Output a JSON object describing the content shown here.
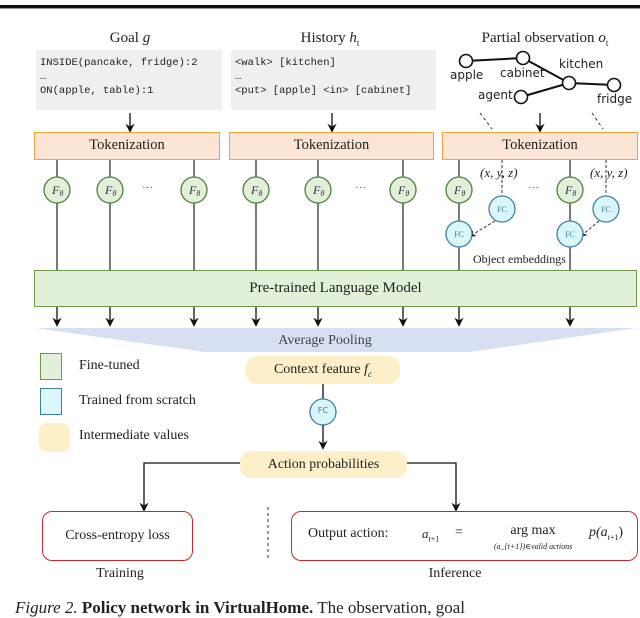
{
  "figure": {
    "columns": [
      {
        "title": "Goal ",
        "title_var": "g",
        "lines": [
          "INSIDE(pancake, fridge):2",
          "…",
          "ON(apple, table):1"
        ]
      },
      {
        "title": "History ",
        "title_var": "h",
        "title_sub": "t",
        "lines": [
          "<walk> [kitchen]",
          "…",
          "<put> [apple] <in> [cabinet]"
        ]
      },
      {
        "title": "Partial observation ",
        "title_var": "o",
        "title_sub": "t",
        "graph_nodes": [
          "apple",
          "cabinet",
          "kitchen",
          "agent",
          "fridge"
        ]
      }
    ],
    "tokenization_label": "Tokenization",
    "f_theta_label": "F",
    "f_theta_sub": "θ",
    "ellipsis": "···",
    "fc_label": "FC",
    "coords_label": "(x, y, z)",
    "object_embeddings_label": "Object embeddings",
    "language_model_label": "Pre-trained Language Model",
    "average_pooling_label": "Average Pooling",
    "context_feature_label": "Context feature ",
    "context_feature_var": "f",
    "context_feature_sub": "c",
    "action_probabilities_label": "Action probabilities",
    "loss_label": "Cross-entropy loss",
    "output_action_label": "Output action:",
    "output_formula": {
      "lhs": "a",
      "lhs_sub": "t+1",
      "eq": "=",
      "op": "arg max",
      "op_under": "(a_{t+1})∈valid actions",
      "rhs": "p(a",
      "rhs_sub": "t+1",
      "rhs_close": ")"
    },
    "training_label": "Training",
    "inference_label": "Inference",
    "legend": [
      {
        "label": "Fine-tuned",
        "fill": "#e2efd9",
        "stroke": "#6a9a4a"
      },
      {
        "label": "Trained from scratch",
        "fill": "#d9f6fb",
        "stroke": "#41809e"
      },
      {
        "label": "Intermediate values",
        "fill": "#fdefc8",
        "stroke": "none"
      }
    ],
    "caption_prefix": "Figure 2.",
    "caption_bold": "Policy network in VirtualHome.",
    "caption_rest": "The observation, goal"
  },
  "colors": {
    "tokenization_fill": "#fce4d6",
    "tokenization_stroke": "#f2a33c",
    "finetuned_fill": "#e2efd9",
    "finetuned_stroke": "#6a9a4a",
    "scratch_fill": "#d9f6fb",
    "scratch_stroke": "#41809e",
    "intermediate_fill": "#fdefc8",
    "pooling_fill": "#d6e0f2",
    "output_stroke": "#c9262c"
  }
}
